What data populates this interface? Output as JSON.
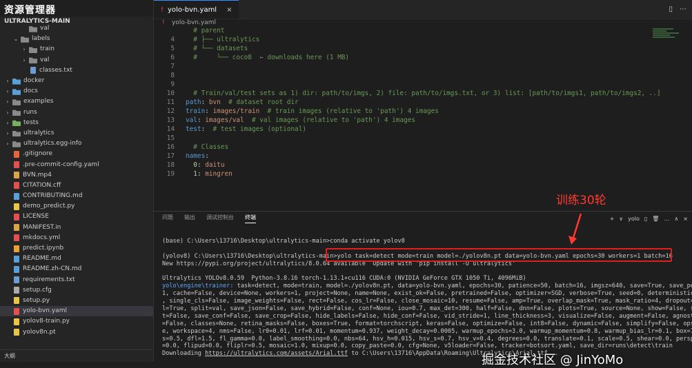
{
  "sidebar": {
    "top_label": "资源管理器",
    "section_title": "ULTRALYTICS-MAIN",
    "items": [
      {
        "label": "val",
        "kind": "folder",
        "indent": 2,
        "chev": "",
        "color": "gray"
      },
      {
        "label": "labels",
        "kind": "folder",
        "indent": 1,
        "chev": "v",
        "color": "gray"
      },
      {
        "label": "train",
        "kind": "folder",
        "indent": 2,
        "chev": ">",
        "color": "gray"
      },
      {
        "label": "val",
        "kind": "folder",
        "indent": 2,
        "chev": ">",
        "color": "gray"
      },
      {
        "label": "classes.txt",
        "kind": "file",
        "indent": 2,
        "chev": "",
        "color": "#6e9bd1"
      },
      {
        "label": "docker",
        "kind": "folder",
        "indent": 0,
        "chev": ">",
        "color": "blue"
      },
      {
        "label": "docs",
        "kind": "folder",
        "indent": 0,
        "chev": ">",
        "color": "blue"
      },
      {
        "label": "examples",
        "kind": "folder",
        "indent": 0,
        "chev": ">",
        "color": "gray"
      },
      {
        "label": "runs",
        "kind": "folder",
        "indent": 0,
        "chev": ">",
        "color": "gray"
      },
      {
        "label": "tests",
        "kind": "folder",
        "indent": 0,
        "chev": ">",
        "color": "green"
      },
      {
        "label": "ultralytics",
        "kind": "folder",
        "indent": 0,
        "chev": ">",
        "color": "gray"
      },
      {
        "label": "ultralytics.egg-info",
        "kind": "folder",
        "indent": 0,
        "chev": ">",
        "color": "gray"
      },
      {
        "label": ".gitignore",
        "kind": "file",
        "indent": 0,
        "chev": "",
        "color": "#e2663a"
      },
      {
        "label": ".pre-commit-config.yaml",
        "kind": "file",
        "indent": 0,
        "chev": "",
        "color": "#e05252"
      },
      {
        "label": "BVN.mp4",
        "kind": "file",
        "indent": 0,
        "chev": "",
        "color": "#d9a44a"
      },
      {
        "label": "CITATION.cff",
        "kind": "file",
        "indent": 0,
        "chev": "",
        "color": "#e05252"
      },
      {
        "label": "CONTRIBUTING.md",
        "kind": "file",
        "indent": 0,
        "chev": "",
        "color": "#5aa0d6"
      },
      {
        "label": "demo_predict.py",
        "kind": "file",
        "indent": 0,
        "chev": "",
        "color": "#e8c547"
      },
      {
        "label": "LICENSE",
        "kind": "file",
        "indent": 0,
        "chev": "",
        "color": "#e05252"
      },
      {
        "label": "MANIFEST.in",
        "kind": "file",
        "indent": 0,
        "chev": "",
        "color": "#d9a44a"
      },
      {
        "label": "mkdocs.yml",
        "kind": "file",
        "indent": 0,
        "chev": "",
        "color": "#e05252"
      },
      {
        "label": "predict.ipynb",
        "kind": "file",
        "indent": 0,
        "chev": "",
        "color": "#e8a23a"
      },
      {
        "label": "README.md",
        "kind": "file",
        "indent": 0,
        "chev": "",
        "color": "#5aa0d6"
      },
      {
        "label": "README.zh-CN.md",
        "kind": "file",
        "indent": 0,
        "chev": "",
        "color": "#5aa0d6"
      },
      {
        "label": "requirements.txt",
        "kind": "file",
        "indent": 0,
        "chev": "",
        "color": "#6e9bd1"
      },
      {
        "label": "setup.cfg",
        "kind": "file",
        "indent": 0,
        "chev": "",
        "color": "#aaaaaa"
      },
      {
        "label": "setup.py",
        "kind": "file",
        "indent": 0,
        "chev": "",
        "color": "#e8c547"
      },
      {
        "label": "yolo-bvn.yaml",
        "kind": "file",
        "indent": 0,
        "chev": "",
        "color": "#e05252",
        "active": true
      },
      {
        "label": "yolov8-train.py",
        "kind": "file",
        "indent": 0,
        "chev": "",
        "color": "#e8c547"
      },
      {
        "label": "yolov8n.pt",
        "kind": "file",
        "indent": 0,
        "chev": "",
        "color": "#e8c547"
      }
    ],
    "bottom_label": "大纲"
  },
  "editor": {
    "tab_label": "yolo-bvn.yaml",
    "tab_close": "×",
    "breadcrumb": "yolo-bvn.yaml",
    "lines": [
      {
        "n": "",
        "t": "  # parent",
        "cls": "c-com"
      },
      {
        "n": "4",
        "t": "  # ├── ultralytics",
        "cls": "c-com"
      },
      {
        "n": "5",
        "t": "  # └── datasets",
        "cls": "c-com"
      },
      {
        "n": "6",
        "t": "  #     └── coco8  ← downloads here (1 MB)",
        "cls": "c-com"
      },
      {
        "n": "7",
        "t": "",
        "cls": ""
      },
      {
        "n": "8",
        "t": "",
        "cls": ""
      },
      {
        "n": "9",
        "t": "",
        "cls": ""
      },
      {
        "n": "10",
        "t": "  # Train/val/test sets as 1) dir: path/to/imgs, 2) file: path/to/imgs.txt, or 3) list: [path/to/imgs1, path/to/imgs2, ..]",
        "cls": "c-com"
      },
      {
        "n": "11",
        "k": "path",
        "v": " bvn",
        "c": "  # dataset root dir"
      },
      {
        "n": "12",
        "k": "train",
        "v": " images/train",
        "c": "  # train images (relative to 'path') 4 images"
      },
      {
        "n": "13",
        "k": "val",
        "v": " images/val",
        "c": "  # val images (relative to 'path') 4 images"
      },
      {
        "n": "14",
        "k": "test",
        "v": "",
        "c": "  # test images (optional)"
      },
      {
        "n": "15",
        "t": "",
        "cls": ""
      },
      {
        "n": "16",
        "t": "  # Classes",
        "cls": "c-com"
      },
      {
        "n": "17",
        "k": "names",
        "v": "",
        "c": ""
      },
      {
        "n": "18",
        "idx": "0",
        "v": " daitu"
      },
      {
        "n": "19",
        "idx": "1",
        "v": " mingren"
      }
    ]
  },
  "panel": {
    "tabs": [
      "问题",
      "输出",
      "调试控制台",
      "终端"
    ],
    "active_tab": "终端",
    "actions": [
      "+",
      "∨",
      "yolo",
      "▯",
      "🗑",
      "…",
      "∧",
      "×"
    ],
    "terminal_lines": [
      {
        "t": "(base) C:\\Users\\13716\\Desktop\\ultralytics-main>conda activate yolov8",
        "cls": ""
      },
      {
        "t": "",
        "cls": ""
      },
      {
        "t": "(yolov8) C:\\Users\\13716\\Desktop\\ultralytics-main>yolo task=detect mode=train model=./yolov8n.pt data=yolo-bvn.yaml epochs=30 workers=1 batch=16",
        "cls": ""
      },
      {
        "t": "New https://pypi.org/project/ultralytics/8.0.64 available  Update with 'pip install -U ultralytics'",
        "cls": ""
      },
      {
        "t": "",
        "cls": ""
      },
      {
        "t": "Ultralytics YOLOv8.0.59  Python-3.8.16 torch-1.13.1+cu116 CUDA:0 (NVIDIA GeForce GTX 1050 Ti, 4096MiB)",
        "cls": ""
      },
      {
        "pre": "yolo\\engine\\trainer:",
        "t": " task=detect, mode=train, model=./yolov8n.pt, data=yolo-bvn.yaml, epochs=30, patience=50, batch=16, imgsz=640, save=True, save_period=-",
        "cls": ""
      },
      {
        "t": "1, cache=False, device=None, workers=1, project=None, name=None, exist_ok=False, pretrained=False, optimizer=SGD, verbose=True, seed=0, deterministic=True",
        "cls": ""
      },
      {
        "t": ", single_cls=False, image_weights=False, rect=False, cos_lr=False, close_mosaic=10, resume=False, amp=True, overlap_mask=True, mask_ratio=4, dropout=0.0, va",
        "cls": ""
      },
      {
        "t": "l=True, split=val, save_json=False, save_hybrid=False, conf=None, iou=0.7, max_det=300, half=False, dnn=False, plots=True, source=None, show=False, save_tx",
        "cls": ""
      },
      {
        "t": "t=False, save_conf=False, save_crop=False, hide_labels=False, hide_conf=False, vid_stride=1, line_thickness=3, visualize=False, augment=False, agnostic_nms",
        "cls": ""
      },
      {
        "t": "=False, classes=None, retina_masks=False, boxes=True, format=torchscript, keras=False, optimize=False, int8=False, dynamic=False, simplify=False, opset=Non",
        "cls": ""
      },
      {
        "t": "e, workspace=4, nms=False, lr0=0.01, lrf=0.01, momentum=0.937, weight_decay=0.0005, warmup_epochs=3.0, warmup_momentum=0.8, warmup_bias_lr=0.1, box=7.5, cl",
        "cls": ""
      },
      {
        "t": "s=0.5, dfl=1.5, fl_gamma=0.0, label_smoothing=0.0, nbs=64, hsv_h=0.015, hsv_s=0.7, hsv_v=0.4, degrees=0.0, translate=0.1, scale=0.5, shear=0.0, perspective",
        "cls": ""
      },
      {
        "t": "=0.0, flipud=0.0, fliplr=0.5, mosaic=1.0, mixup=0.0, copy_paste=0.0, cfg=None, v5loader=False, tracker=botsort.yaml, save_dir=runs\\detect\\train",
        "cls": ""
      },
      {
        "t": "Downloading ",
        "link": "https://ultralytics.com/assets/Arial.ttf",
        "tail": " to C:\\Users\\13716\\AppData\\Roaming\\Ultralytics\\Arial.ttf...",
        "cls": ""
      }
    ]
  },
  "annotation": {
    "label": "训练30轮",
    "color": "#ff3b30"
  },
  "watermark": "掘金技术社区 @ JinYoMo"
}
